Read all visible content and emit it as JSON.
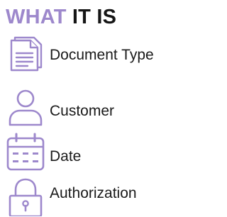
{
  "heading": {
    "accent_word": "WHAT",
    "rest": "IT IS",
    "accent_color": "#9d88cc"
  },
  "items": [
    {
      "icon": "document-icon",
      "label": "Document Type"
    },
    {
      "icon": "user-icon",
      "label": "Customer"
    },
    {
      "icon": "calendar-icon",
      "label": "Date"
    },
    {
      "icon": "lock-icon",
      "label": "Authorization"
    }
  ],
  "icon_color": "#9d88cc"
}
